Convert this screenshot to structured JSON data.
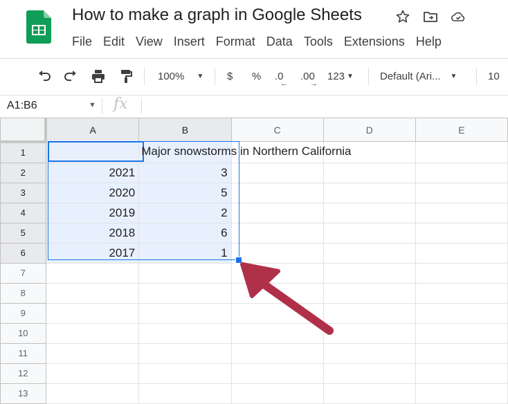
{
  "app": {
    "doc_title": "How to make a graph in Google Sheets",
    "brand_color": "#0f9d58"
  },
  "header_icons": [
    {
      "icon": "star-icon"
    },
    {
      "icon": "move-to-folder-icon"
    },
    {
      "icon": "cloud-saved-icon"
    }
  ],
  "menu": [
    "File",
    "Edit",
    "View",
    "Insert",
    "Format",
    "Data",
    "Tools",
    "Extensions",
    "Help"
  ],
  "toolbar": {
    "zoom": "100%",
    "currency": "$",
    "percent": "%",
    "decrease_decimal": ".0",
    "increase_decimal": ".00",
    "more_formats": "123",
    "font": "Default (Ari...",
    "font_size": "10"
  },
  "formula_bar": {
    "range": "A1:B6",
    "fx_label": "fx",
    "value": ""
  },
  "grid": {
    "columns": [
      "A",
      "B",
      "C",
      "D",
      "E"
    ],
    "rows": [
      {
        "num": "1",
        "a": "",
        "b": "Major snowstorms in Northern California"
      },
      {
        "num": "2",
        "a": "2021",
        "b": "3"
      },
      {
        "num": "3",
        "a": "2020",
        "b": "5"
      },
      {
        "num": "4",
        "a": "2019",
        "b": "2"
      },
      {
        "num": "5",
        "a": "2018",
        "b": "6"
      },
      {
        "num": "6",
        "a": "2017",
        "b": "1"
      },
      {
        "num": "7",
        "a": "",
        "b": ""
      },
      {
        "num": "8",
        "a": "",
        "b": ""
      },
      {
        "num": "9",
        "a": "",
        "b": ""
      },
      {
        "num": "10",
        "a": "",
        "b": ""
      },
      {
        "num": "11",
        "a": "",
        "b": ""
      },
      {
        "num": "12",
        "a": "",
        "b": ""
      },
      {
        "num": "13",
        "a": "",
        "b": ""
      }
    ],
    "selection_color": "#1a73e8",
    "selection_fill": "#e8f0fe"
  },
  "annotation": {
    "icon": "pointer-arrow-icon",
    "color": "#b0304a"
  }
}
